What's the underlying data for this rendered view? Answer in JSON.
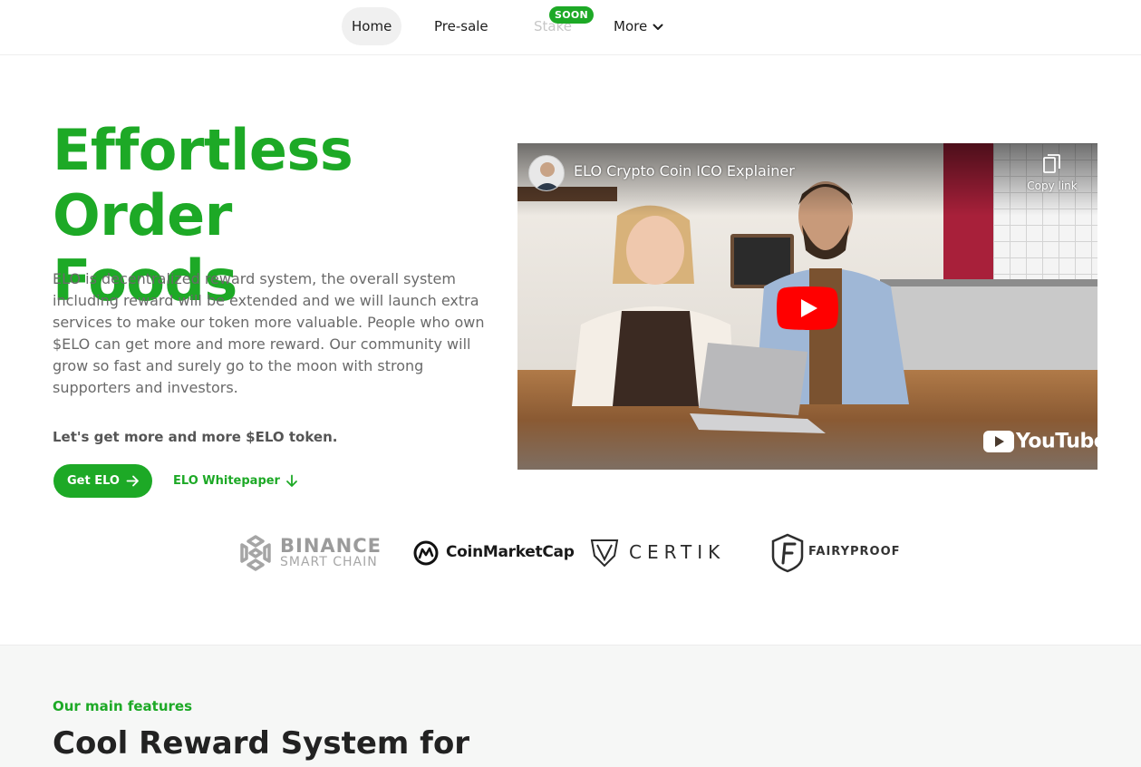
{
  "colors": {
    "accent": "#1da926",
    "text_dark": "#222222",
    "text_muted": "#6a6a6a"
  },
  "nav": {
    "items": [
      {
        "label": "Home",
        "active": true
      },
      {
        "label": "Pre-sale",
        "active": false
      },
      {
        "label": "Stake",
        "active": false,
        "disabled": true,
        "badge": "SOON"
      },
      {
        "label": "More",
        "active": false,
        "icon": "chevron-down-icon"
      }
    ]
  },
  "hero": {
    "title_line1": "Effortless Order",
    "title_line2": "Foods",
    "description": "ELO is decentralized reward system, the overall system including reward will be extended and we will launch extra services to make our token more valuable. People who own $ELO can get more and more reward. Our community will grow so fast and surely go to the moon with strong supporters and investors.",
    "cta_text": "Let's get more and more $ELO token.",
    "primary_button": "Get ELO",
    "secondary_link": "ELO Whitepaper"
  },
  "video": {
    "title": "ELO Crypto Coin ICO Explainer",
    "copy_link": "Copy link",
    "brand": "YouTube"
  },
  "partners": {
    "binance_line1": "BINANCE",
    "binance_line2": "SMART CHAIN",
    "coinmarketcap": "CoinMarketCap",
    "certik": "CERTIK",
    "fairyproof": "FAIRYPROOF"
  },
  "features": {
    "eyebrow": "Our main features",
    "title": "Cool Reward System for"
  }
}
